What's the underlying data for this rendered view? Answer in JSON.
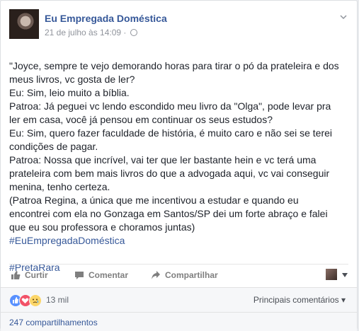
{
  "post": {
    "page_name": "Eu Empregada Doméstica",
    "timestamp": "21 de julho às 14:09 ·",
    "privacy_icon": "globe-icon",
    "body": "\"Joyce, sempre te vejo demorando horas para tirar o pó da prateleira e dos meus livros, vc gosta de ler?\nEu: Sim, leio muito a bíblia.\nPatroa: Já peguei vc lendo escondido meu livro da \"Olga\", pode levar pra ler em casa, você já pensou em continuar os seus estudos?\nEu: Sim, quero fazer faculdade de história, é muito caro e não sei se terei condições de pagar.\nPatroa: Nossa que incrível, vai ter que ler bastante hein e vc terá uma prateleira com bem mais livros do que a advogada aqui, vc vai conseguir menina, tenho certeza.\n(Patroa Regina, a única que me incentivou a estudar e quando eu encontrei com ela no Gonzaga em Santos/SP dei um forte abraço e falei que eu sou professora e choramos juntas)",
    "hashtags": [
      "#EuEmpregadaDoméstica",
      "#PretaRara"
    ]
  },
  "actions": {
    "like": "Curtir",
    "comment": "Comentar",
    "share": "Compartilhar"
  },
  "reactions": {
    "icons": [
      "like-icon",
      "love-icon",
      "sad-icon"
    ],
    "count": "13 mil",
    "comments_order": "Principais comentários ▾"
  },
  "shares": {
    "label": "247 compartilhamentos"
  },
  "colors": {
    "link": "#365899",
    "like": "#5890ff",
    "love": "#f25268",
    "sad": "#fcd669"
  }
}
